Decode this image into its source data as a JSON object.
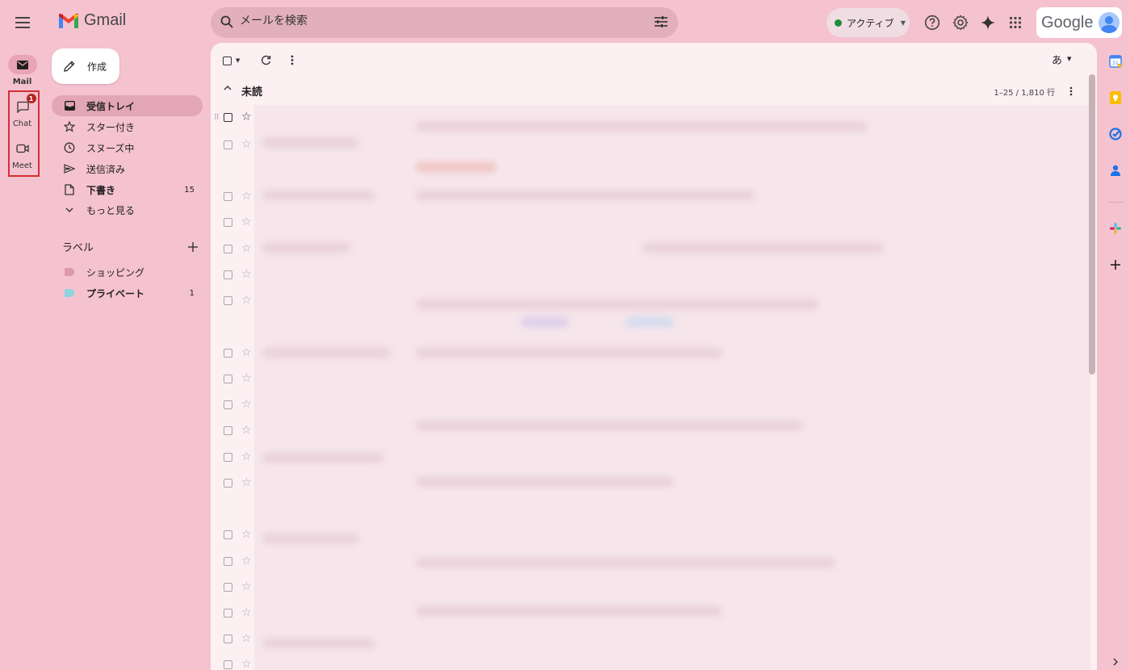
{
  "app": {
    "name": "Gmail"
  },
  "search": {
    "placeholder": "メールを検索"
  },
  "status": {
    "label": "アクティブ",
    "color": "#1e8e3e"
  },
  "brand": {
    "google_word": "Google"
  },
  "rail": {
    "items": [
      {
        "label": "Mail",
        "icon": "mail-icon",
        "active": true
      },
      {
        "label": "Chat",
        "icon": "chat-icon",
        "badge": "1"
      },
      {
        "label": "Meet",
        "icon": "video-icon"
      }
    ]
  },
  "compose": {
    "label": "作成"
  },
  "nav": {
    "items": [
      {
        "label": "受信トレイ",
        "icon": "inbox-icon",
        "active": true
      },
      {
        "label": "スター付き",
        "icon": "star-icon"
      },
      {
        "label": "スヌーズ中",
        "icon": "clock-icon"
      },
      {
        "label": "送信済み",
        "icon": "send-icon"
      },
      {
        "label": "下書き",
        "icon": "draft-icon",
        "count": "15",
        "bold": true
      },
      {
        "label": "もっと見る",
        "icon": "chevron-down-icon"
      }
    ]
  },
  "labels": {
    "heading": "ラベル",
    "items": [
      {
        "label": "ショッピング",
        "color": "#d999aa"
      },
      {
        "label": "プライベート",
        "color": "#8fd3e0",
        "count": "1",
        "bold": true
      }
    ]
  },
  "toolbar": {
    "input_mode": "あ"
  },
  "section": {
    "title": "未読",
    "range": "1–25 / 1,810 行"
  },
  "colors": {
    "background": "#f5c2d0",
    "main": "#fcf0f3",
    "active_nav": "#e2a6b6",
    "badge": "#b3261e",
    "highlight_box": "#d32f2f"
  }
}
